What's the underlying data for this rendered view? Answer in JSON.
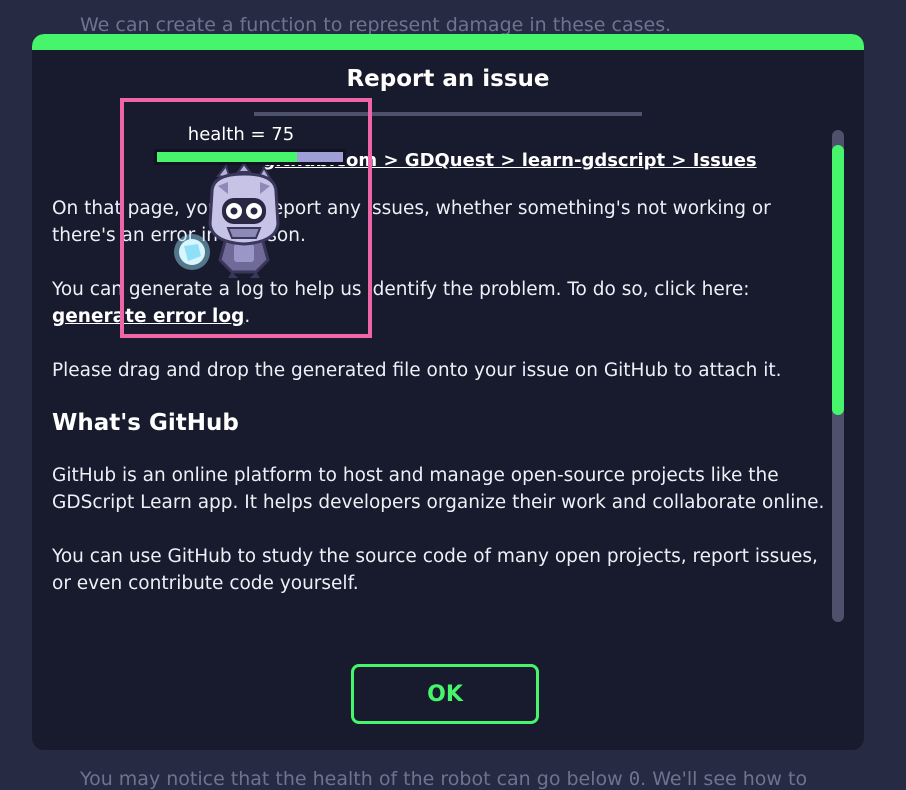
{
  "background": {
    "top_text": "We can create a function to represent damage in these cases.",
    "bottom_text_before_code": "You may notice that the health of the robot can go below ",
    "bottom_code": "0",
    "bottom_text_after_code": ". We'll see how to"
  },
  "dialog": {
    "title": "Report an issue",
    "link_path": "github.com > GDQuest > learn-gdscript > Issues",
    "paragraph_1": "On that page, you can report any issues, whether something's not working or there's an error in a lesson.",
    "paragraph_2_text": "You can generate a log to help us identify the problem. To do so, click here: ",
    "paragraph_2_link": "generate error log",
    "paragraph_2_end": ".",
    "paragraph_3": "Please drag and drop the generated file onto your issue on GitHub to attach it.",
    "heading": "What's GitHub",
    "paragraph_4": "GitHub is an online platform to host and manage open-source projects like the GDScript Learn app. It helps developers organize their work and collaborate online.",
    "paragraph_5": "You can use GitHub to study the source code of many open projects, report issues, or even contribute code yourself.",
    "ok_label": "OK",
    "scroll_position": 0.04
  },
  "robot_panel": {
    "health_label": "health = 75",
    "health_value": 75,
    "health_max": 100,
    "icon": "robot-icon"
  },
  "colors": {
    "accent": "#46f56c",
    "panel_border": "#f065a8",
    "dialog_bg": "#181a2d",
    "page_bg": "#262a42"
  }
}
